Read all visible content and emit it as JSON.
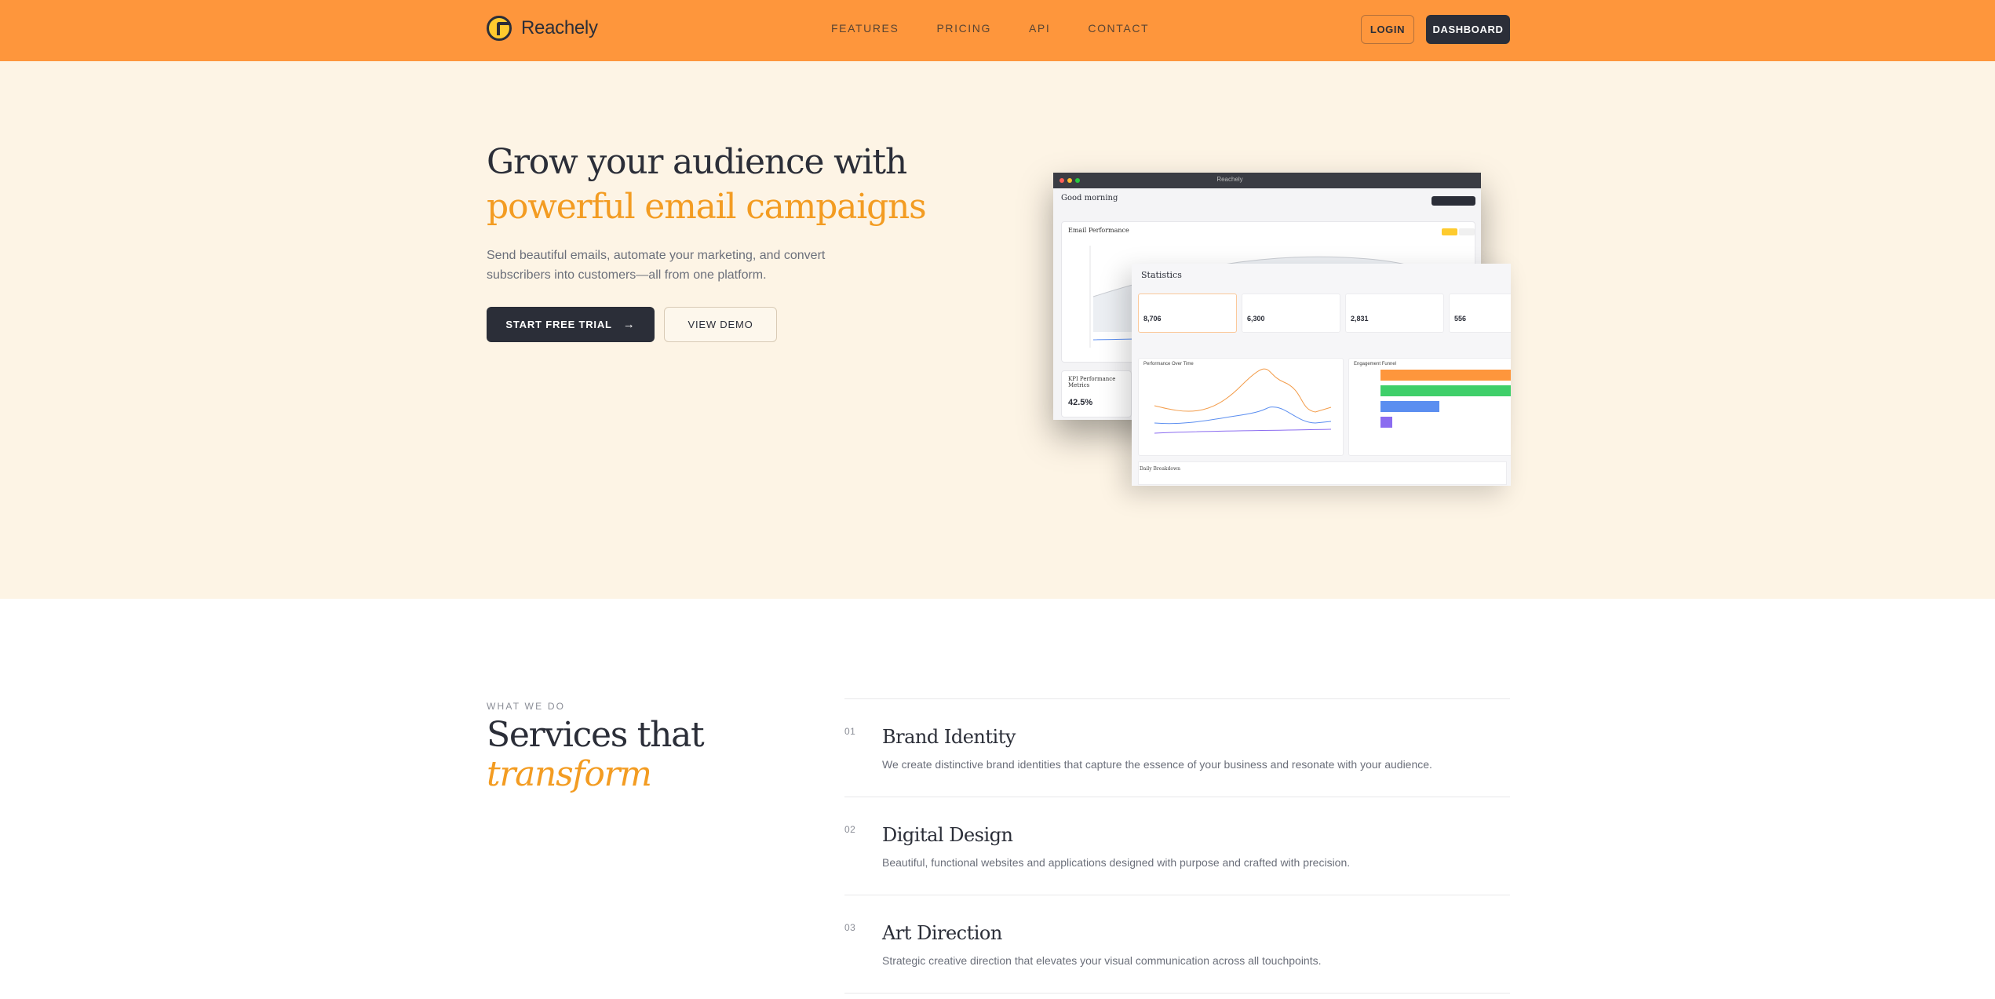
{
  "brand": {
    "name": "Reachely",
    "icon": "reachely-logo-icon"
  },
  "nav": {
    "links": [
      "FEATURES",
      "PRICING",
      "API",
      "CONTACT"
    ],
    "login": "LOGIN",
    "dashboard": "DASHBOARD"
  },
  "hero": {
    "title_line1": "Grow your audience with",
    "title_line2": "powerful email campaigns",
    "subtitle": "Send beautiful emails, automate your marketing, and convert subscribers into customers—all from one platform.",
    "cta_primary": "START FREE TRIAL",
    "cta_primary_icon": "arrow-right-icon",
    "cta_secondary": "VIEW DEMO"
  },
  "mockup_dashboard": {
    "window_title": "Reachely",
    "greeting": "Good morning",
    "card_title": "Email Performance",
    "kpi_title": "KPI Performance Metrics",
    "kpi_value": "42.5%"
  },
  "mockup_statistics": {
    "title": "Statistics",
    "stats": [
      "8,706",
      "6,300",
      "2,831",
      "556"
    ],
    "panel_left": "Performance Over Time",
    "panel_right": "Engagement Funnel",
    "footer": "Daily Breakdown"
  },
  "services": {
    "eyebrow": "WHAT WE DO",
    "title_line1": "Services that",
    "title_line2": "transform",
    "items": [
      {
        "num": "01",
        "title": "Brand Identity",
        "desc": "We create distinctive brand identities that capture the essence of your business and resonate with your audience."
      },
      {
        "num": "02",
        "title": "Digital Design",
        "desc": "Beautiful, functional websites and applications designed with purpose and crafted with precision."
      },
      {
        "num": "03",
        "title": "Art Direction",
        "desc": "Strategic creative direction that elevates your visual communication across all touchpoints."
      }
    ]
  },
  "colors": {
    "nav_bg": "#fe963c",
    "hero_bg": "#fdf4e5",
    "accent": "#f39c22",
    "dark": "#2b2e38"
  }
}
